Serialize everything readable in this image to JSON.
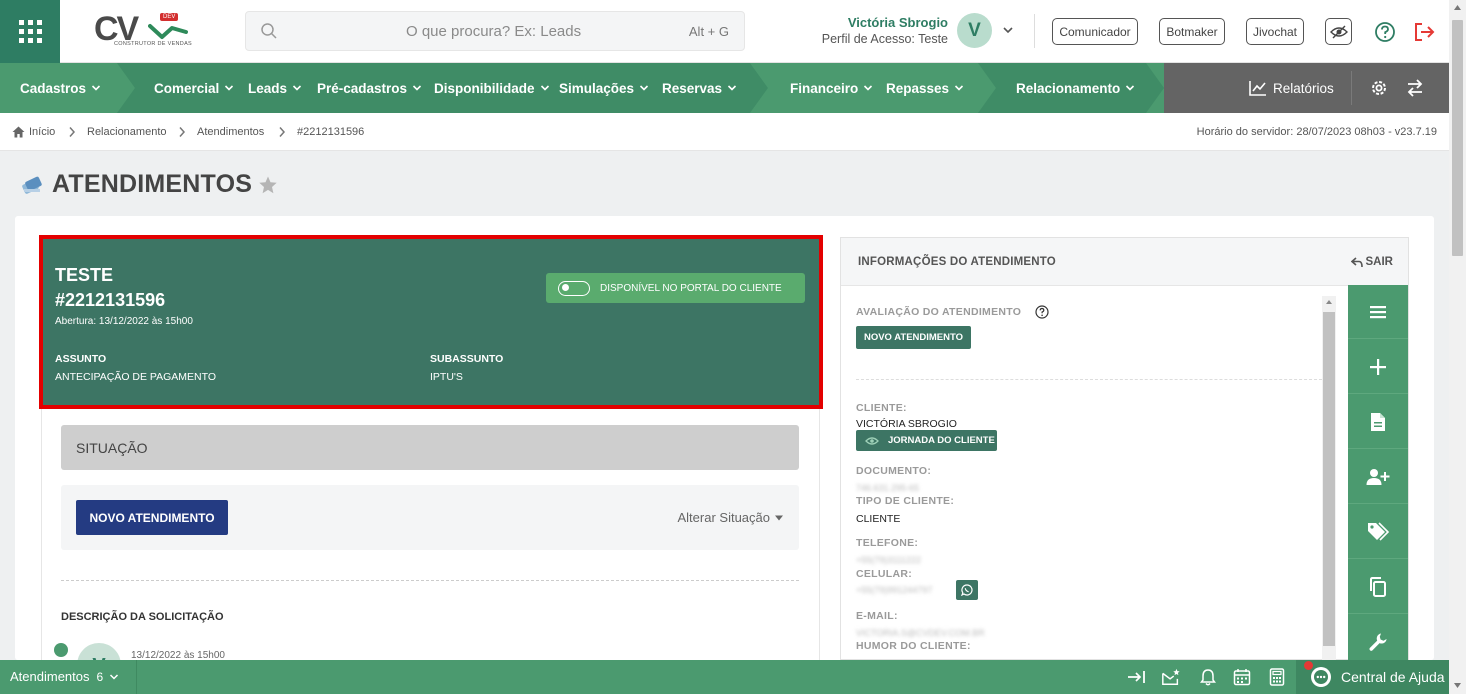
{
  "header": {
    "search_placeholder": "O que procura? Ex: Leads",
    "search_shortcut": "Alt + G",
    "logo": {
      "main": "CV",
      "badge": "DEV",
      "subtitle": "CONSTRUTOR DE VENDAS"
    },
    "user_name": "Victória Sbrogio",
    "user_profile": "Perfil de Acesso: Teste",
    "avatar_letter": "V",
    "buttons": [
      "Comunicador",
      "Botmaker",
      "Jivochat"
    ]
  },
  "nav": {
    "items": [
      "Cadastros",
      "Comercial",
      "Leads",
      "Pré-cadastros",
      "Disponibilidade",
      "Simulações",
      "Reservas",
      "Financeiro",
      "Repasses",
      "Relacionamento"
    ],
    "reports": "Relatórios"
  },
  "breadcrumb": {
    "items": [
      "Início",
      "Relacionamento",
      "Atendimentos",
      "#2212131596"
    ],
    "server_time": "Horário do servidor: 28/07/2023 08h03 - v23.7.19"
  },
  "page": {
    "title": "ATENDIMENTOS"
  },
  "ticket": {
    "name": "TESTE",
    "number": "#2212131596",
    "opening": "Abertura: 13/12/2022 às 15h00",
    "portal_label": "DISPONÍVEL NO PORTAL DO CLIENTE",
    "subject_label": "ASSUNTO",
    "subject_value": "ANTECIPAÇÃO DE PAGAMENTO",
    "subsubject_label": "SUBASSUNTO",
    "subsubject_value": "IPTU'S"
  },
  "situation": {
    "title": "SITUAÇÃO",
    "button": "NOVO ATENDIMENTO",
    "change": "Alterar Situação"
  },
  "description": {
    "title": "DESCRIÇÃO DA SOLICITAÇÃO",
    "avatar_letter": "V",
    "date": "13/12/2022 às 15h00"
  },
  "info": {
    "title": "INFORMAÇÕES DO ATENDIMENTO",
    "exit": "SAIR",
    "rating_label": "AVALIAÇÃO DO ATENDIMENTO",
    "rating_tag": "NOVO ATENDIMENTO",
    "client_label": "CLIENTE:",
    "client_value": "VICTÓRIA SBROGIO",
    "journey_button": "JORNADA DO CLIENTE",
    "document_label": "DOCUMENTO:",
    "document_value": "746.631.295-65",
    "client_type_label": "TIPO DE CLIENTE:",
    "client_type_value": "CLIENTE",
    "phone_label": "TELEFONE:",
    "phone_value": "+55(79)3111222",
    "mobile_label": "CELULAR:",
    "mobile_value": "+55(79)991244797",
    "email_label": "E-MAIL:",
    "email_value": "VICTORIA.S@CVDEV.COM.BR",
    "mood_label": "HUMOR DO CLIENTE:"
  },
  "bottom": {
    "label": "Atendimentos",
    "count": "6",
    "help": "Central de Ajuda"
  },
  "colors": {
    "brand_green": "#4b9a6f",
    "dark_green": "#3d7564",
    "highlight_red": "#e30000",
    "navy": "#243b82"
  }
}
